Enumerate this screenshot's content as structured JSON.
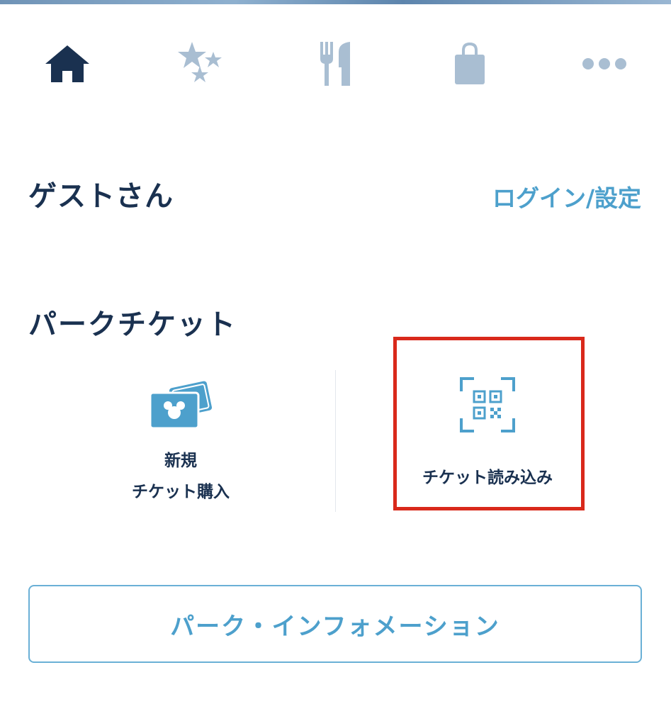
{
  "nav": {
    "items": [
      {
        "name": "home",
        "icon": "home-icon",
        "active": true
      },
      {
        "name": "attractions",
        "icon": "stars-icon",
        "active": false
      },
      {
        "name": "restaurants",
        "icon": "fork-knife-icon",
        "active": false
      },
      {
        "name": "shopping",
        "icon": "shopping-bag-icon",
        "active": false
      },
      {
        "name": "more",
        "icon": "more-dots-icon",
        "active": false
      }
    ]
  },
  "user": {
    "guest_name": "ゲストさん",
    "login_label": "ログイン/設定"
  },
  "park_ticket": {
    "title": "パークチケット",
    "buy": {
      "icon": "ticket-cards-icon",
      "line1": "新規",
      "line2": "チケット購入"
    },
    "read": {
      "icon": "qr-scan-icon",
      "label": "チケット読み込み"
    }
  },
  "park_info": {
    "label": "パーク・インフォメーション"
  },
  "colors": {
    "primary_dark": "#1a3150",
    "accent_blue": "#4da0cc",
    "inactive_icon": "#a9bed2",
    "highlight_red": "#d9291b"
  }
}
